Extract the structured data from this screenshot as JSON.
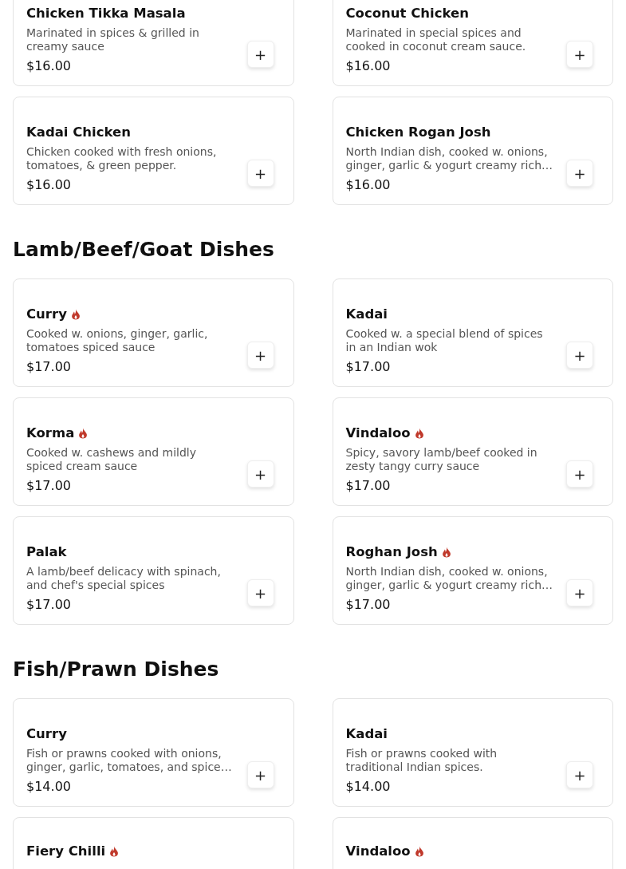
{
  "sections": [
    {
      "items": [
        {
          "name": "Chicken Tikka Masala",
          "spicy": false,
          "description": "Marinated in spices & grilled in creamy sauce",
          "price": "$16.00",
          "button": "+"
        },
        {
          "name": "Coconut Chicken",
          "spicy": false,
          "description": "Marinated in special spices and cooked in coconut cream sauce.",
          "price": "$16.00",
          "button": "+"
        },
        {
          "name": "Kadai Chicken",
          "spicy": false,
          "description": "Chicken cooked with fresh onions, tomatoes, & green pepper.",
          "price": "$16.00",
          "button": "+"
        },
        {
          "name": "Chicken Rogan Josh",
          "spicy": false,
          "description": "North Indian dish, cooked w. onions, ginger, garlic & yogurt creamy rich…",
          "price": "$16.00",
          "button": "+"
        }
      ]
    },
    {
      "title": "Lamb/Beef/Goat Dishes",
      "items": [
        {
          "name": "Curry",
          "spicy": true,
          "description": "Cooked w. onions, ginger, garlic, tomatoes spiced sauce",
          "price": "$17.00",
          "button": "+"
        },
        {
          "name": "Kadai",
          "spicy": false,
          "description": "Cooked w. a special blend of spices in an Indian wok",
          "price": "$17.00",
          "button": "+"
        },
        {
          "name": "Korma",
          "spicy": true,
          "description": "Cooked w. cashews and mildly spiced cream sauce",
          "price": "$17.00",
          "button": "+"
        },
        {
          "name": "Vindaloo",
          "spicy": true,
          "description": "Spicy, savory lamb/beef cooked in zesty tangy curry sauce",
          "price": "$17.00",
          "button": "+"
        },
        {
          "name": "Palak",
          "spicy": false,
          "description": "A lamb/beef delicacy with spinach, and chef's special spices",
          "price": "$17.00",
          "button": "+"
        },
        {
          "name": "Roghan Josh",
          "spicy": true,
          "description": "North Indian dish, cooked w. onions, ginger, garlic & yogurt creamy rich…",
          "price": "$17.00",
          "button": "+"
        }
      ]
    },
    {
      "title": "Fish/Prawn Dishes",
      "items": [
        {
          "name": "Curry",
          "spicy": false,
          "description": "Fish or prawns cooked with onions, ginger, garlic, tomatoes, and spice…",
          "price": "$14.00",
          "button": "+"
        },
        {
          "name": "Kadai",
          "spicy": false,
          "description": "Fish or prawns cooked with traditional Indian spices.",
          "price": "$14.00",
          "button": "+"
        },
        {
          "name": "Fiery Chilli",
          "spicy": true
        },
        {
          "name": "Vindaloo",
          "spicy": true
        }
      ]
    }
  ]
}
